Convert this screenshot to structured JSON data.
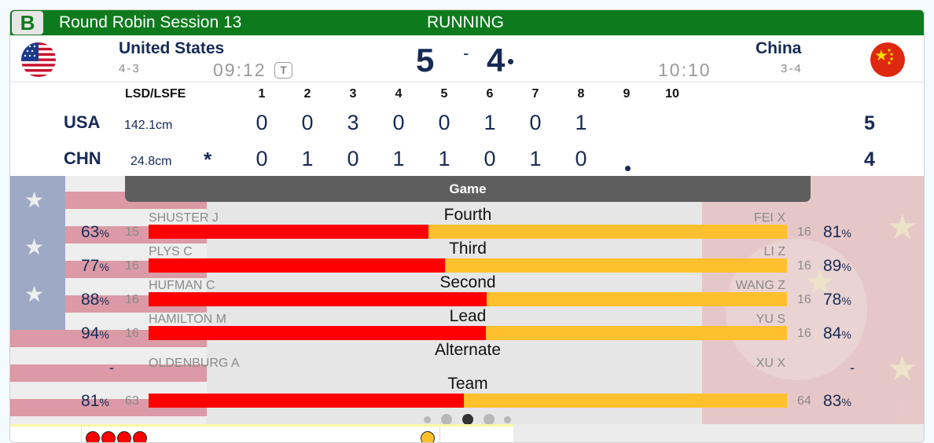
{
  "header": {
    "badge": "B",
    "session": "Round Robin Session 13",
    "status": "RUNNING",
    "brand_color": "#0d7a1d"
  },
  "teams": {
    "home": {
      "name": "United States",
      "record": "4-3",
      "clock": "09:12",
      "timeout_icon": "T",
      "score": "5",
      "flag": "usa-flag-icon"
    },
    "away": {
      "name": "China",
      "record": "3-4",
      "clock": "10:10",
      "score": "4",
      "flag": "china-flag-icon"
    },
    "score_separator": "-"
  },
  "linescore": {
    "headers": [
      "LSD/LSFE",
      "1",
      "2",
      "3",
      "4",
      "5",
      "6",
      "7",
      "8",
      "9",
      "10"
    ],
    "rows": [
      {
        "abbr": "USA",
        "lsd": "142.1cm",
        "ends": [
          "0",
          "0",
          "3",
          "0",
          "0",
          "1",
          "0",
          "1"
        ],
        "total": "5"
      },
      {
        "abbr": "CHN",
        "lsd": "24.8cm",
        "lsfe_marker": "*",
        "ends": [
          "0",
          "1",
          "0",
          "1",
          "1",
          "0",
          "1",
          "0"
        ],
        "total": "4"
      }
    ]
  },
  "stats": {
    "tab": "Game",
    "rows": [
      {
        "position": "Fourth",
        "left_name": "SHUSTER J",
        "left_pct": "63",
        "left_shots": "15",
        "right_name": "FEI X",
        "right_pct": "81",
        "right_shots": "16",
        "split": 0.439
      },
      {
        "position": "Third",
        "left_name": "PLYS C",
        "left_pct": "77",
        "left_shots": "16",
        "right_name": "LI Z",
        "right_pct": "89",
        "right_shots": "16",
        "split": 0.464
      },
      {
        "position": "Second",
        "left_name": "HUFMAN C",
        "left_pct": "88",
        "left_shots": "16",
        "right_name": "WANG Z",
        "right_pct": "78",
        "right_shots": "16",
        "split": 0.53
      },
      {
        "position": "Lead",
        "left_name": "HAMILTON M",
        "left_pct": "94",
        "left_shots": "16",
        "right_name": "YU S",
        "right_pct": "84",
        "right_shots": "16",
        "split": 0.528
      },
      {
        "position": "Alternate",
        "left_name": "OLDENBURG A",
        "left_pct": "-",
        "right_name": "XU X",
        "right_pct": "-"
      },
      {
        "position": "Team",
        "left_pct": "81",
        "left_shots": "63",
        "right_pct": "83",
        "right_shots": "64",
        "split": 0.494
      }
    ],
    "percent_sign": "%",
    "colors": {
      "usa": "#ff0000",
      "chn": "#ffc02e"
    }
  },
  "pager": {
    "pages": 5,
    "active": 2
  },
  "bottom": {
    "red_stones": 4,
    "yellow_stones": 1
  }
}
